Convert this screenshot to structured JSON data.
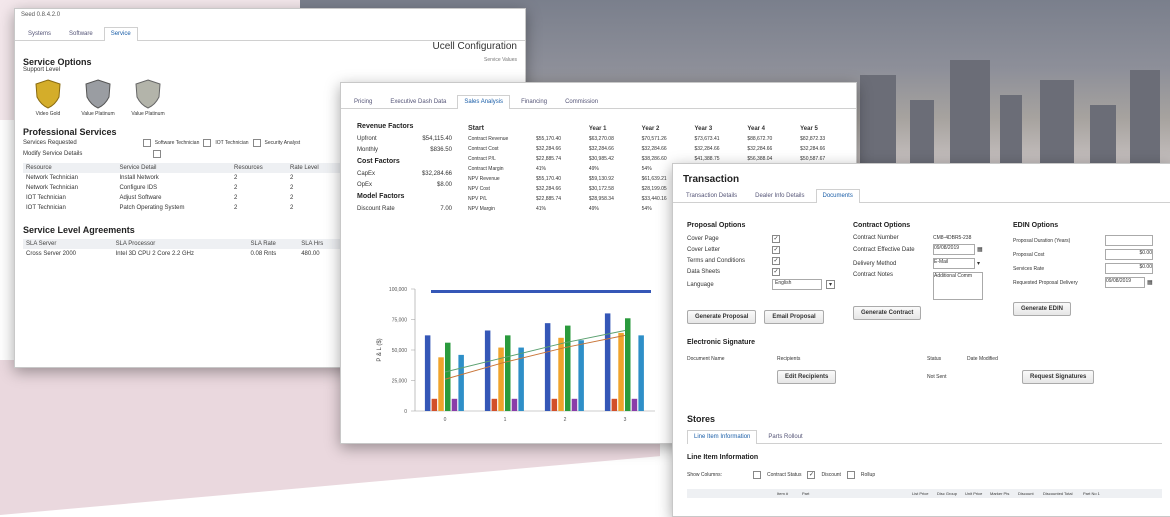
{
  "w1": {
    "header": "Seed 0.8.4.2.0",
    "tabs": [
      "Systems",
      "Software",
      "Service"
    ],
    "title": "Ucell Configuration",
    "subtitle": "Service Values",
    "service_options": "Service Options",
    "support_level": "Support Level",
    "shields": [
      {
        "label": "Video Gold",
        "color": "#c9a227"
      },
      {
        "label": "Value Platinum",
        "color": "#8f9296"
      },
      {
        "label": "Value Platinum",
        "color": "#a9aaa0"
      }
    ],
    "prof_title": "Professional Services",
    "services_requested": "Services Requested",
    "modify_details": "Modify Service Details",
    "requested_opts": [
      "Software Technician",
      "IOT Technician",
      "Security Analyst"
    ],
    "ps_headers": [
      "Resource",
      "Service Detail",
      "Resources",
      "Rate Level"
    ],
    "ps_rows": [
      [
        "Network Technician",
        "Install Network",
        "2",
        "2"
      ],
      [
        "Network Technician",
        "Configure IDS",
        "2",
        "2"
      ],
      [
        "IOT Technician",
        "Adjust Software",
        "2",
        "2"
      ],
      [
        "IOT Technician",
        "Patch Operating System",
        "2",
        "2"
      ]
    ],
    "sla_title": "Service Level Agreements",
    "sla_headers": [
      "SLA Server",
      "SLA Processor",
      "SLA Rate",
      "SLA Hrs"
    ],
    "sla_rows": [
      [
        "Cross Server 2000",
        "Intel 3D CPU 2 Core 2.2 GHz",
        "0.08 Rnts",
        "480.00"
      ]
    ]
  },
  "w2": {
    "tabs": [
      "Pricing",
      "Executive Dash Data",
      "Sales Analysis",
      "Financing",
      "Commission"
    ],
    "rev_title": "Revenue Factors",
    "rev_rows": [
      [
        "Upfront",
        "$54,115.40"
      ],
      [
        "Monthly",
        "$836.50"
      ]
    ],
    "cost_title": "Cost Factors",
    "cost_rows": [
      [
        "CapEx",
        "$32,284.66"
      ],
      [
        "OpEx",
        "$8.00"
      ]
    ],
    "model_title": "Model Factors",
    "model_rows": [
      [
        "Discount Rate",
        "7.00"
      ]
    ],
    "start_title": "Start",
    "year_headers": [
      "Year 1",
      "Year 2",
      "Year 3",
      "Year 4",
      "Year 5"
    ],
    "metrics": [
      [
        "Contract Revenue",
        "$55,170.40",
        "$63,270.08",
        "$70,571.26",
        "$73,673.41",
        "$88,672.70",
        "$82,872.33"
      ],
      [
        "Contract Cost",
        "$32,284.66",
        "$32,284.66",
        "$32,284.66",
        "$32,284.66",
        "$32,284.66",
        "$32,284.66"
      ],
      [
        "Contract P/L",
        "$22,885.74",
        "$30,985.42",
        "$38,286.60",
        "$41,388.75",
        "$56,388.04",
        "$50,587.67"
      ],
      [
        "Contract Margin",
        "41%",
        "49%",
        "54%",
        "56%",
        "64%",
        "61%"
      ],
      [
        "NPV Revenue",
        "$55,170.40",
        "$59,130.92",
        "$61,639.21",
        "$60,141.02",
        "$67,649.34",
        "$59,085.12"
      ],
      [
        "NPV Cost",
        "$32,284.66",
        "$30,172.58",
        "$28,199.05",
        "$26,354.26",
        "$24,630.15",
        "$23,018.83"
      ],
      [
        "NPV P/L",
        "$22,885.74",
        "$28,958.34",
        "$33,440.16",
        "$33,786.76",
        "$43,019.19",
        "$36,066.29"
      ],
      [
        "NPV Margin",
        "41%",
        "49%",
        "54%",
        "56%",
        "64%",
        "61%"
      ]
    ]
  },
  "chart_data": {
    "type": "bar",
    "ylabel": "P & L ($)",
    "yticks": [
      "0",
      "25,000",
      "50,000",
      "75,000",
      "100,000"
    ],
    "ylim": [
      0,
      100000
    ],
    "categories": [
      "0",
      "1",
      "2",
      "3"
    ],
    "series": [
      {
        "color": "#3557b7",
        "values": [
          62000,
          66000,
          72000,
          80000
        ]
      },
      {
        "color": "#d24f2a",
        "values": [
          10000,
          10000,
          10000,
          10000
        ]
      },
      {
        "color": "#f0a42c",
        "values": [
          44000,
          52000,
          60000,
          64000
        ]
      },
      {
        "color": "#2a9a3c",
        "values": [
          56000,
          62000,
          70000,
          76000
        ]
      },
      {
        "color": "#8a3ca8",
        "values": [
          10000,
          10000,
          10000,
          10000
        ]
      },
      {
        "color": "#2e8fc8",
        "values": [
          46000,
          52000,
          58000,
          62000
        ]
      }
    ],
    "trend": [
      [
        0,
        26000
      ],
      [
        1,
        40000
      ],
      [
        2,
        52000
      ],
      [
        3,
        62000
      ]
    ],
    "trend2": [
      [
        0,
        32000
      ],
      [
        1,
        44000
      ],
      [
        2,
        56000
      ],
      [
        3,
        66000
      ]
    ]
  },
  "w3": {
    "title": "Transaction",
    "tabs": [
      "Transaction Details",
      "Dealer Info Details",
      "Documents"
    ],
    "proposal_title": "Proposal Options",
    "proposal_rows": [
      "Cover Page",
      "Cover Letter",
      "Terms and Conditions",
      "Data Sheets",
      "Language"
    ],
    "language_value": "English",
    "contract_title": "Contract Options",
    "contract_rows": [
      {
        "label": "Contract Number",
        "value": "CM8-4DBR5-238"
      },
      {
        "label": "Contract Effective Date",
        "value": "09/08/2019"
      },
      {
        "label": "Delivery Method",
        "value": "E-Mail"
      },
      {
        "label": "Contract Notes",
        "value": ""
      }
    ],
    "notes_value": "Additional Comm",
    "edin_title": "EDIN Options",
    "edin_rows": [
      {
        "label": "Proposal Duration (Years)",
        "value": ""
      },
      {
        "label": "Proposal Cost",
        "value": "$0.00"
      },
      {
        "label": "Services Rate",
        "value": "$0.00"
      },
      {
        "label": "Requested Proposal Delivery",
        "value": "09/08/2019"
      }
    ],
    "btn_generate_proposal": "Generate Proposal",
    "btn_email_proposal": "Email Proposal",
    "btn_generate_contract": "Generate Contract",
    "btn_generate_edin": "Generate EDIN",
    "esig_title": "Electronic Signature",
    "esig_headers": [
      "Document Name",
      "Recipients",
      "Status",
      "Date Modified"
    ],
    "btn_edit_recipients": "Edit Recipients",
    "status_value": "Not Sent",
    "btn_request_signatures": "Request Signatures",
    "stores_title": "Stores",
    "stores_tabs": [
      "Line Item Information",
      "Parts Rollout"
    ],
    "line_info_title": "Line Item Information",
    "show_columns": "Show Columns:",
    "show_opts": [
      "Contract Status",
      "Discount",
      "Rollup"
    ],
    "bottom_cols": [
      "Item #",
      "Part",
      "List Price",
      "Disc Group",
      "Unit Price",
      "Marker Pts",
      "Discount",
      "Discounted Total",
      "Part No 1"
    ]
  }
}
